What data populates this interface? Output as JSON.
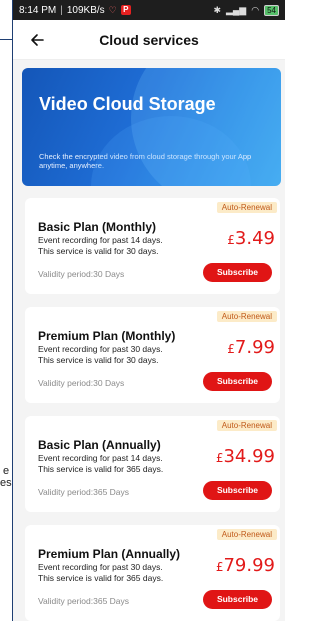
{
  "status": {
    "time": "8:14 PM",
    "speed": "109KB/s",
    "battery": "54"
  },
  "header": {
    "title": "Cloud services"
  },
  "side_fragments": [
    "e",
    "es"
  ],
  "banner": {
    "title": "Video Cloud Storage",
    "description": "Check the encrypted video from cloud storage through your App anytime, anywhere."
  },
  "plans": [
    {
      "badge": "Auto-Renewal",
      "name": "Basic Plan (Monthly)",
      "line1": "Event recording for past 14 days.",
      "line2": "This service is valid for 30 days.",
      "currency": "£",
      "price": "3.49",
      "validity": "Validity period:30 Days",
      "button": "Subscribe"
    },
    {
      "badge": "Auto-Renewal",
      "name": "Premium Plan (Monthly)",
      "line1": "Event recording for past 30 days.",
      "line2": "This service is valid for 30 days.",
      "currency": "£",
      "price": "7.99",
      "validity": "Validity period:30 Days",
      "button": "Subscribe"
    },
    {
      "badge": "Auto-Renewal",
      "name": "Basic Plan (Annually)",
      "line1": "Event recording for past 14 days.",
      "line2": "This service is valid for 365 days.",
      "currency": "£",
      "price": "34.99",
      "validity": "Validity period:365 Days",
      "button": "Subscribe"
    },
    {
      "badge": "Auto-Renewal",
      "name": "Premium Plan (Annually)",
      "line1": "Event recording for past 30 days.",
      "line2": "This service is valid for 365 days.",
      "currency": "£",
      "price": "79.99",
      "validity": "Validity period:365 Days",
      "button": "Subscribe"
    }
  ],
  "colors": {
    "accent": "#e01515",
    "price": "#e21a1a",
    "badge_bg": "#fcebc8",
    "badge_text": "#c05a1a",
    "banner": "#1f6ed6"
  },
  "icons": {
    "back": "arrow-left-icon"
  }
}
